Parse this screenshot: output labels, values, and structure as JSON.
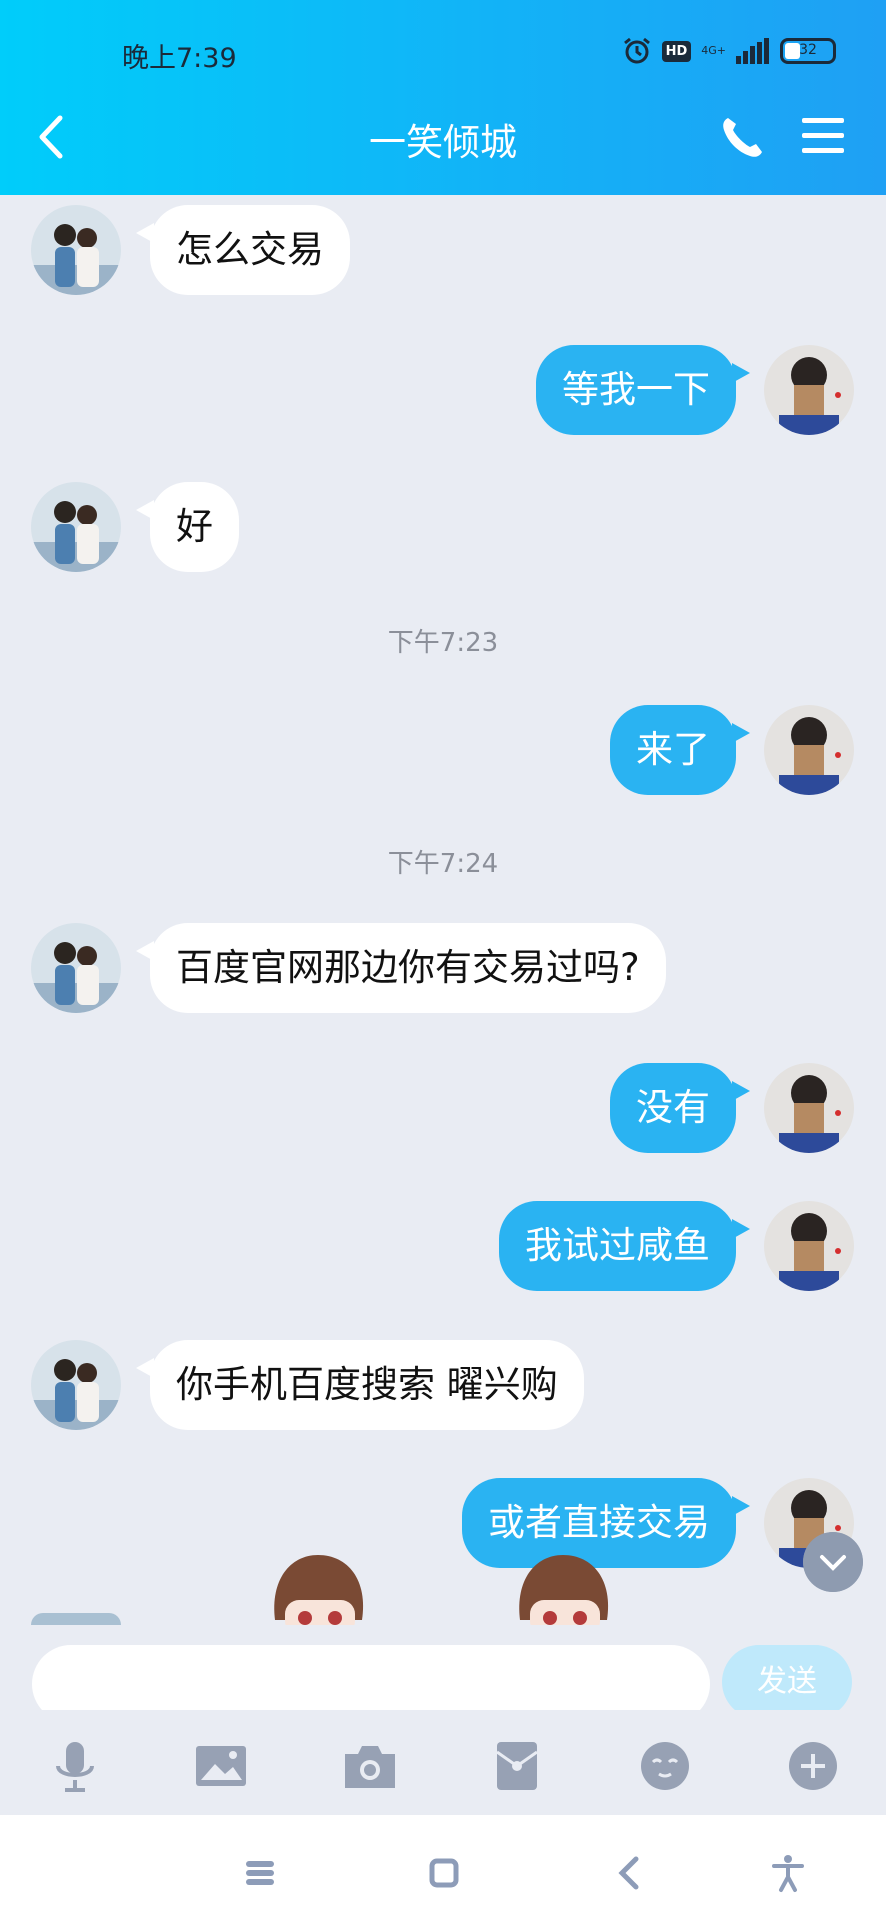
{
  "status_bar": {
    "time": "晚上7:39",
    "hd": "HD",
    "network": "4G+",
    "battery": "32"
  },
  "header": {
    "title": "一笑倾城"
  },
  "messages": [
    {
      "side": "left",
      "text": "怎么交易"
    },
    {
      "side": "right",
      "text": "等我一下"
    },
    {
      "side": "left",
      "text": "好"
    },
    {
      "time": "下午7:23"
    },
    {
      "side": "right",
      "text": "来了"
    },
    {
      "time": "下午7:24"
    },
    {
      "side": "left",
      "text": "百度官网那边你有交易过吗?"
    },
    {
      "side": "right",
      "text": "没有"
    },
    {
      "side": "right",
      "text": "我试过咸鱼"
    },
    {
      "side": "left",
      "text": "你手机百度搜索  曜兴购"
    },
    {
      "side": "right",
      "text": "或者直接交易"
    }
  ],
  "input": {
    "send_label": "发送"
  },
  "colors": {
    "header_start": "#00cdfa",
    "header_end": "#1fa0f4",
    "bubble_mine": "#2ab3f2",
    "bubble_theirs": "#ffffff",
    "background": "#e9ecf3"
  },
  "icons": {
    "toolbar": [
      "microphone-icon",
      "image-icon",
      "camera-icon",
      "red-packet-icon",
      "emoji-icon",
      "plus-icon"
    ],
    "nav": [
      "menu-icon",
      "home-icon",
      "back-icon",
      "accessibility-icon"
    ]
  }
}
